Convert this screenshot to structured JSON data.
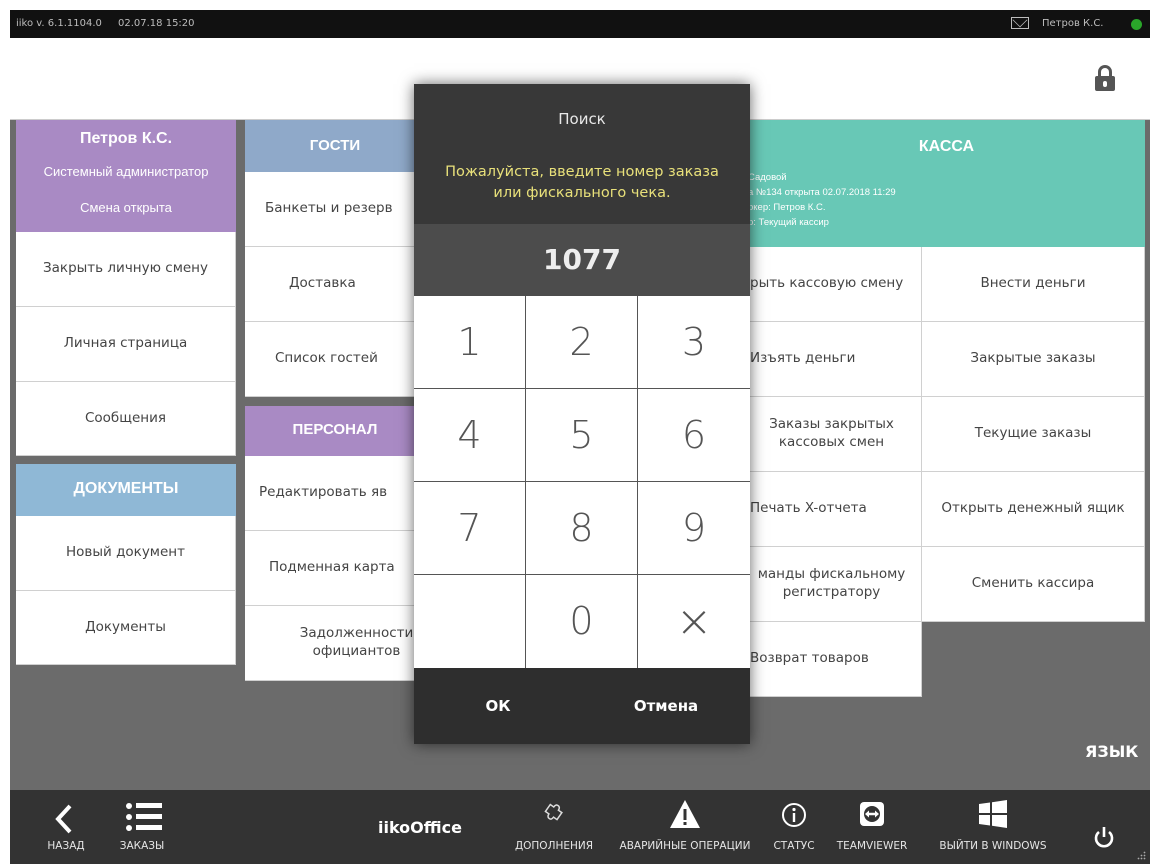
{
  "status": {
    "version": "iiko v. 6.1.1104.0",
    "datetime": "02.07.18 15:20",
    "user": "Петров К.С."
  },
  "user_panel": {
    "name": "Петров К.С.",
    "role": "Системный администратор",
    "shift": "Смена открыта",
    "items": [
      "Закрыть личную смену",
      "Личная страница",
      "Сообщения"
    ]
  },
  "documents": {
    "title": "ДОКУМЕНТЫ",
    "items": [
      "Новый документ",
      "Документы"
    ]
  },
  "guests": {
    "title": "ГОСТИ",
    "items": [
      "Банкеты и резерв",
      "Доставка",
      "Список гостей"
    ]
  },
  "staff": {
    "title": "ПЕРСОНАЛ",
    "items": [
      "Редактировать яв",
      "Подменная карта",
      "Задолженности официантов"
    ]
  },
  "kassa": {
    "title": "КАССА",
    "lines": [
      "Садовой",
      "а №134 открыта 02.07.2018 11:29",
      "ркер: Петров К.С.",
      "р: Текущий кассир"
    ],
    "left_items": [
      "рыть кассовую смену",
      "Изъять деньги",
      "Заказы закрытых кассовых смен",
      "Печать X-отчета",
      "манды фискальному регистратору",
      "Возврат товаров"
    ],
    "right_items": [
      "Внести деньги",
      "Закрытые заказы",
      "Текущие заказы",
      "Открыть денежный ящик",
      "Сменить кассира"
    ]
  },
  "dialog": {
    "title": "Поиск",
    "message": "Пожалуйста, введите номер заказа или фискального чека.",
    "value": "1077",
    "keys": [
      "1",
      "2",
      "3",
      "4",
      "5",
      "6",
      "7",
      "8",
      "9",
      "",
      "0",
      "×"
    ],
    "ok": "ОК",
    "cancel": "Отмена"
  },
  "language": "ЯЗЫК",
  "bottom": {
    "back": "НАЗАД",
    "orders": "ЗАКАЗЫ",
    "office": "iikoOffice",
    "addons": "ДОПОЛНЕНИЯ",
    "emergency": "АВАРИЙНЫЕ ОПЕРАЦИИ",
    "status": "СТАТУС",
    "teamviewer": "TEAMVIEWER",
    "exit_windows": "ВЫЙТИ В WINDOWS"
  },
  "colors": {
    "user_header": "#a98ac4",
    "documents_header": "#8fb8d6",
    "guests_header": "#8fa9c9",
    "kassa_header": "#68c8b6",
    "dialog_message": "#e8e07a"
  }
}
